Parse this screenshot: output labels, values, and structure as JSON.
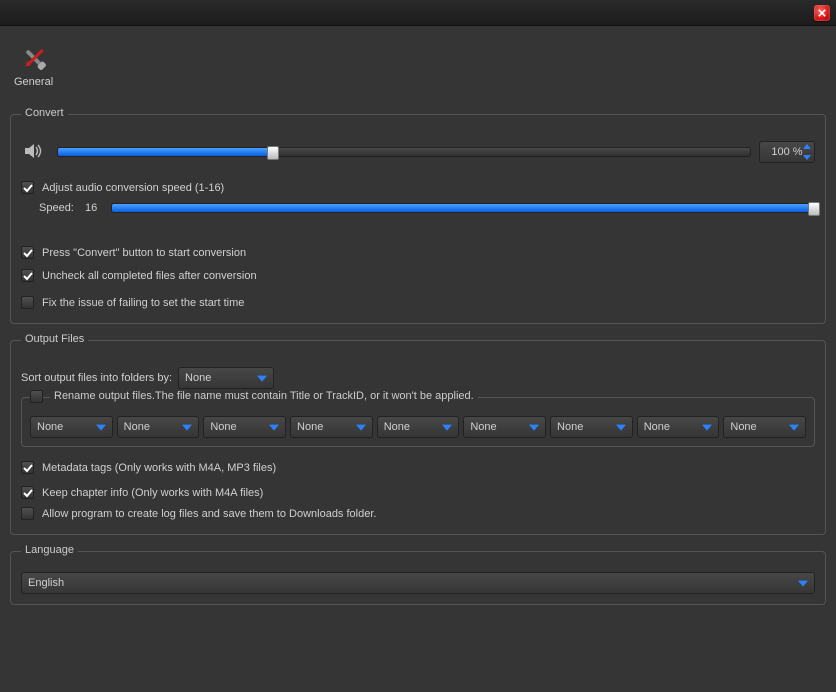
{
  "tab": {
    "general": "General"
  },
  "convert": {
    "title": "Convert",
    "volume_percent": "100 %",
    "volume_fill_pct": 31,
    "adjust_speed": {
      "checked": true,
      "label": "Adjust audio conversion speed (1-16)"
    },
    "speed_label": "Speed:",
    "speed_value": "16",
    "speed_fill_pct": 100,
    "press_convert": {
      "checked": true,
      "label": "Press \"Convert\" button to start conversion"
    },
    "uncheck_completed": {
      "checked": true,
      "label": "Uncheck all completed files after conversion"
    },
    "fix_start_time": {
      "checked": false,
      "label": "Fix the issue of failing to set the start time"
    }
  },
  "output": {
    "title": "Output Files",
    "sort_label": "Sort output files into folders by:",
    "sort_value": "None",
    "rename": {
      "checked": false,
      "label": "Rename output files.The file name must contain Title or TrackID, or it won't be applied."
    },
    "placeholders": [
      "None",
      "None",
      "None",
      "None",
      "None",
      "None",
      "None",
      "None",
      "None"
    ],
    "metadata": {
      "checked": true,
      "label": "Metadata tags (Only works with M4A, MP3 files)"
    },
    "chapter": {
      "checked": true,
      "label": "Keep chapter info (Only works with M4A files)"
    },
    "logfiles": {
      "checked": false,
      "label": "Allow program to create log files and save them to Downloads folder."
    }
  },
  "language": {
    "title": "Language",
    "value": "English"
  }
}
